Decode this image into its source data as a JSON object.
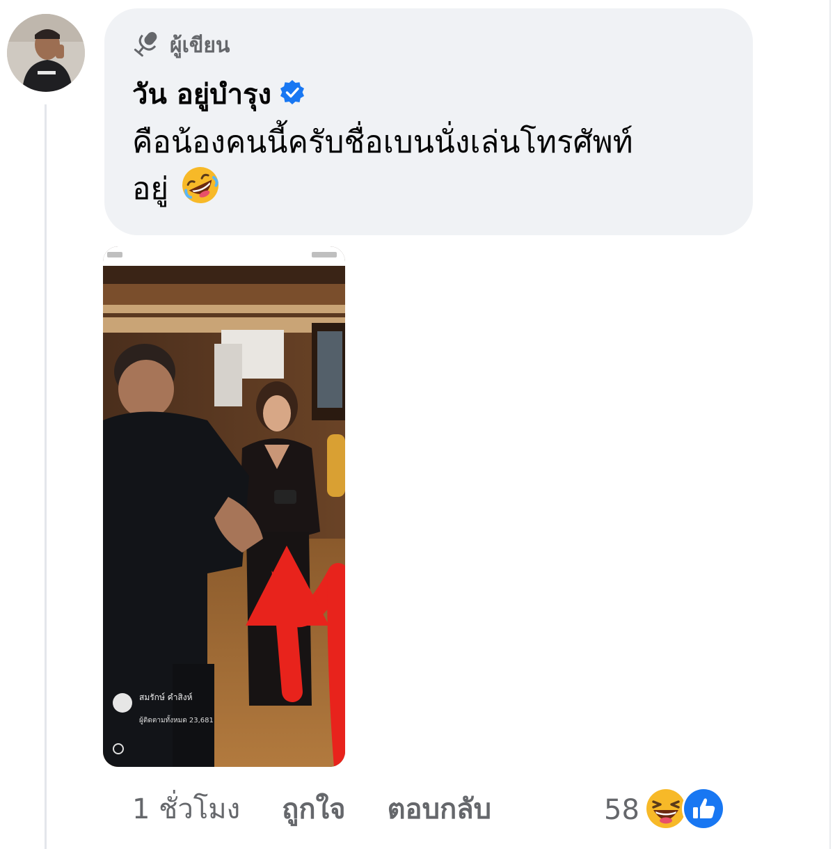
{
  "comment": {
    "author_badge_icon": "microphone-icon",
    "author_badge_label": "ผู้เขียน",
    "author_name": "วัน อยู่บำรุง",
    "verified_icon": "verified-badge-icon",
    "text_line1": "คือน้องคนนี้ครับชื่อเบนนั่งเล่นโทรศัพท์",
    "text_line2": "อยู่",
    "text_emoji": "rolling-laughing-emoji",
    "attached_image": {
      "overlay_name": "สมรักษ์ คำสิงห์",
      "overlay_subtitle": "ผู้ติดตามทั้งหมด 23,681"
    }
  },
  "actions": {
    "time": "1 ชั่วโมง",
    "like": "ถูกใจ",
    "reply": "ตอบกลับ"
  },
  "reactions": {
    "count": "58",
    "icons": [
      "haha-reaction-icon",
      "like-reaction-icon"
    ]
  },
  "colors": {
    "bubble": "#f0f2f5",
    "muted_text": "#65676b",
    "verified_blue": "#1877f2",
    "arrow_red": "#e8231c"
  }
}
